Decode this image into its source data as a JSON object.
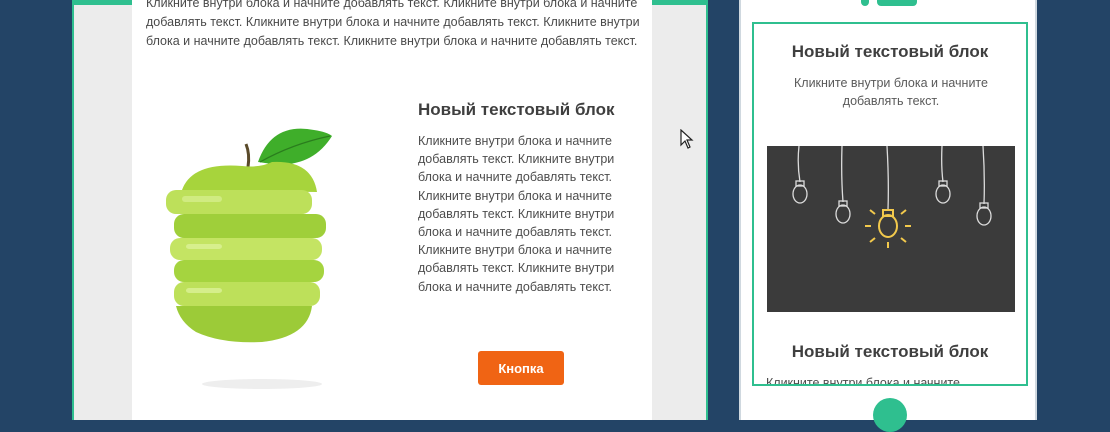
{
  "desktop": {
    "intro_text": "Кликните внутри блока и начните добавлять текст. Кликните внутри блока и начните добавлять текст. Кликните внутри блока и начните добавлять текст. Кликните внутри блока и начните добавлять текст. Кликните внутри блока и начните добавлять текст.",
    "block_title": "Новый текстовый блок",
    "block_text": "Кликните внутри блока и начните добавлять текст. Кликните внутри блока и начните добавлять текст. Кликните внутри блока и начните добавлять текст. Кликните внутри блока и начните добавлять текст. Кликните внутри блока и начните добавлять текст. Кликните внутри блока и начните добавлять текст.",
    "button_label": "Кнопка",
    "image_icon": "green-apple-image"
  },
  "mobile": {
    "block1_title": "Новый текстовый блок",
    "block1_text": "Кликните внутри блока и начните добавлять текст.",
    "image_icon": "light-bulbs-image",
    "block2_title": "Новый текстовый блок",
    "block2_text": "Кликните внутри блока и начните добавлять текст."
  },
  "colors": {
    "background": "#234466",
    "accent": "#2fbf8f",
    "button": "#f06414"
  }
}
